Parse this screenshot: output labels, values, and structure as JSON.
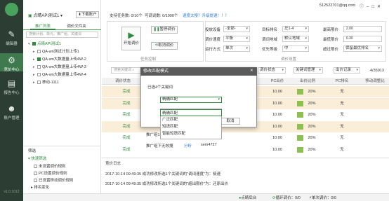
{
  "app": {
    "version": "v1.0.1012"
  },
  "nav": [
    {
      "label": "编辑器",
      "icon": "edit-icon"
    },
    {
      "label": "竞价中心",
      "icon": "bid-icon"
    },
    {
      "label": "报告中心",
      "icon": "report-icon"
    },
    {
      "label": "账户管理",
      "icon": "account-icon"
    }
  ],
  "account": {
    "name": "点睛API测试1",
    "download": "下载账户"
  },
  "tabs": [
    "推广列表",
    "调价文件夹"
  ],
  "search_placeholder": "搜索计划、单元、推广组、关键词",
  "tree": [
    {
      "label": "点睛API测试1",
      "expanded": true,
      "checked": true
    },
    {
      "label": "QA-wn测试计划上传1",
      "checked": false
    },
    {
      "label": "QA-wn大数据量上传4W-2",
      "checked": true
    },
    {
      "label": "QA-wn大数据量上传4W-3",
      "checked": false
    },
    {
      "label": "QA-wn大数据量上传4W-4",
      "checked": false
    },
    {
      "label": "移动-1111",
      "checked": false
    }
  ],
  "filter": {
    "title": "筛选",
    "quick": "快速筛选",
    "items": [
      "未设置调价规则",
      "PC设置调价规则",
      "已设置移动调价规则",
      "排名变化"
    ]
  },
  "header": {
    "tasks": "支持任务数: 0/10个",
    "keywords": "可调词数: 0/1000个",
    "upgrade": "速度太慢？升级提速！！！",
    "email": "512522701@qq.com"
  },
  "task": {
    "start": "开始调价",
    "pause": "暂停调价",
    "cancel": "取消调价",
    "group": "任务控制"
  },
  "settings": {
    "device_label": "投放设备",
    "device_val": "-全部-",
    "speed_label": "调价速度",
    "speed_val": "平衡",
    "mode_label": "运行方式",
    "mode_val": "单次",
    "rank_label": "目标排名",
    "rank_val": "左1-4",
    "region_label": "调词地域",
    "region_val": "默认地域",
    "priority_label": "优先等级",
    "priority_val": "中",
    "max_label": "最高限价",
    "max_val": "2.00",
    "min_label": "最低限价",
    "min_val": "0.30",
    "exceed_label": "超过限价",
    "exceed_val": "保留最优排名",
    "group": "调价设置"
  },
  "toolbar": {
    "search_ph": "搜索关键词",
    "match_sel": "调价状态",
    "export": "批量编辑",
    "cycle": "调价状态",
    "keyword_mgmt": "关键词管理",
    "export_sel": "出价记录",
    "pager": "4/35013"
  },
  "columns": [
    "调价状态",
    "PC出价",
    "出价比例",
    "PC排名",
    "移动调整比"
  ],
  "rows": [
    {
      "status": "完成",
      "pc": "10.00",
      "ratio": "20%",
      "rank": "无",
      "bg": "#fbeed9"
    },
    {
      "status": "完成",
      "pc": "10.00",
      "ratio": "20%",
      "rank": "无",
      "bg": "#fbeed9"
    },
    {
      "status": "完成",
      "pc": "10.00",
      "ratio": "20%",
      "rank": "无",
      "bg": "#fff"
    },
    {
      "status": "完成",
      "pc": "10.00",
      "ratio": "20%",
      "rank": "无",
      "bg": "#fbeed9"
    },
    {
      "status": "完成",
      "pc": "10.00",
      "ratio": "20%",
      "rank": "无",
      "bg": "#fff"
    },
    {
      "status": "完成",
      "pc": "10.00",
      "ratio": "20%",
      "rank": "无",
      "bg": "#fff"
    }
  ],
  "row_extra": [
    {
      "text": "推广组1-关键词"
    },
    {
      "text": "推广组下无效搜",
      "link": "分析",
      "kw": "sem4727"
    }
  ],
  "modal": {
    "title": "修改匹配模式",
    "count": "已选4个关键词",
    "current": "精确匹配",
    "options": [
      "精确匹配",
      "广泛匹配",
      "短语匹配",
      "智能短语匹配"
    ],
    "ok": "确定",
    "cancel": "取消"
  },
  "log": {
    "title": "竞价日志",
    "lines": [
      "2017-10-14 09:49:35 成功修改所选1个关键词的\"调词速度\"为：极速",
      "2017-10-14 09:49:35 成功修改所选1个关键词的\"超出限价\"为：还原出价"
    ]
  },
  "statusbar": {
    "a": "点睛后台",
    "b": "循环调价：0/0",
    "c": "单次调价：0/0"
  }
}
